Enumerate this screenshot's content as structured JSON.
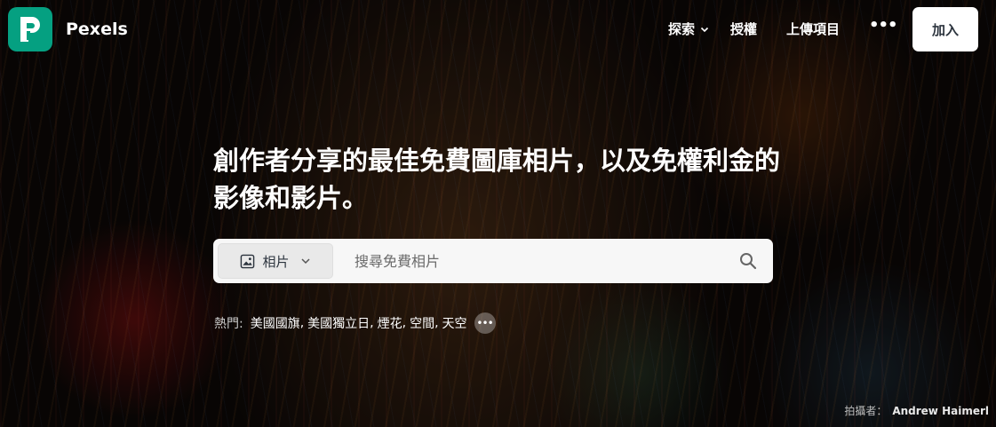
{
  "header": {
    "brand": "Pexels",
    "nav": {
      "explore": "探索",
      "license": "授權",
      "upload": "上傳項目",
      "more": "•••"
    },
    "join": "加入"
  },
  "hero": {
    "headline": "創作者分享的最佳免費圖庫相片，以及免權利金的影像和影片。",
    "search": {
      "type_selected": "相片",
      "placeholder": "搜尋免費相片"
    },
    "trending": {
      "label": "熱門:",
      "tags": [
        "美國國旗",
        "美國獨立日",
        "煙花",
        "空間",
        "天空"
      ],
      "more": "•••"
    }
  },
  "credit": {
    "label": "拍攝者：",
    "author": "Andrew Haimerl"
  },
  "colors": {
    "brand": "#05a081",
    "join_bg": "#ffffff",
    "search_bg": "#f7f7f7"
  }
}
